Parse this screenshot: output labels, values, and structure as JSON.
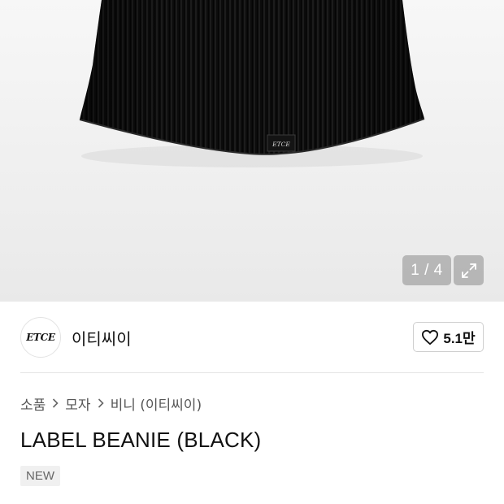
{
  "gallery": {
    "counter": "1 / 4",
    "label_text": "ETCE",
    "expand_icon": "expand-icon"
  },
  "brand": {
    "logo_text": "ETCE",
    "name": "이티씨이",
    "like_count": "5.1만",
    "like_icon": "heart-icon"
  },
  "breadcrumb": {
    "items": [
      "소품",
      "모자",
      "비니 (이티씨이)"
    ],
    "separator_icon": "chevron-right-icon"
  },
  "product": {
    "title": "LABEL BEANIE (BLACK)",
    "badge": "NEW"
  }
}
